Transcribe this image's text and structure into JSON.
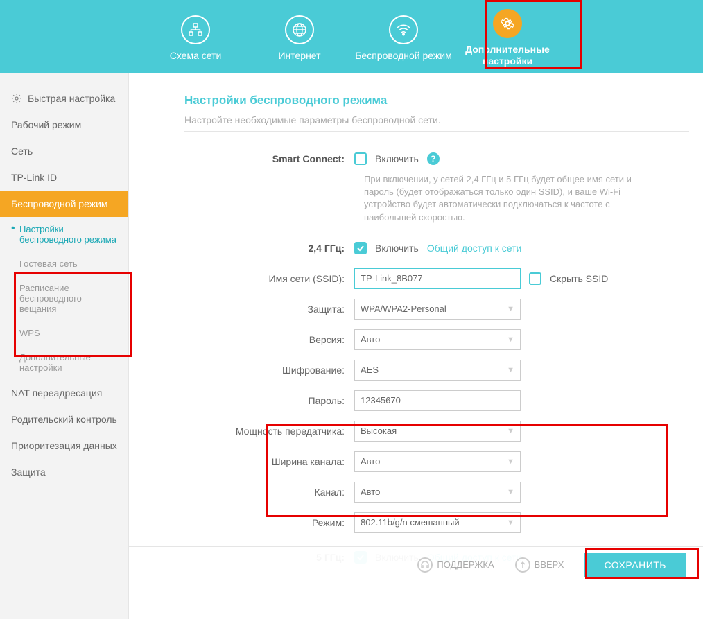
{
  "topnav": {
    "items": [
      {
        "label": "Схема сети"
      },
      {
        "label": "Интернет"
      },
      {
        "label": "Беспроводной режим"
      },
      {
        "label": "Дополнительные настройки"
      }
    ]
  },
  "sidebar": {
    "quick": "Быстрая настройка",
    "items": [
      "Рабочий режим",
      "Сеть",
      "TP-Link ID",
      "Беспроводной режим"
    ],
    "subs": [
      "Настройки беспроводного режима",
      "Гостевая сеть",
      "Расписание беспроводного вещания",
      "WPS",
      "Дополнительные настройки"
    ],
    "items2": [
      "NAT переадресация",
      "Родительский контроль",
      "Приоритезация данных",
      "Защита"
    ]
  },
  "page": {
    "title": "Настройки беспроводного режима",
    "subtitle": "Настройте необходимые параметры беспроводной сети."
  },
  "form": {
    "smart_connect_label": "Smart Connect:",
    "enable": "Включить",
    "smart_hint": "При включении, у сетей 2,4 ГГц и 5 ГГц будет общее имя сети и пароль (будет отображаться только один SSID), и ваше Wi-Fi устройство будет автоматически подключаться к частоте с наибольшей скоростью.",
    "band24_label": "2,4 ГГц:",
    "sharing": "Общий доступ к сети",
    "ssid_label": "Имя сети (SSID):",
    "ssid_value": "TP-Link_8B077",
    "hide_ssid": "Скрыть SSID",
    "security_label": "Защита:",
    "security_value": "WPA/WPA2-Personal",
    "version_label": "Версия:",
    "version_value": "Авто",
    "encryption_label": "Шифрование:",
    "encryption_value": "AES",
    "password_label": "Пароль:",
    "password_value": "12345670",
    "txpower_label": "Мощность передатчика:",
    "txpower_value": "Высокая",
    "chwidth_label": "Ширина канала:",
    "chwidth_value": "Авто",
    "channel_label": "Канал:",
    "channel_value": "Авто",
    "mode_label": "Режим:",
    "mode_value": "802.11b/g/n смешанный",
    "band5_label": "5 ГГц:"
  },
  "footer": {
    "support": "ПОДДЕРЖКА",
    "top": "ВВЕРХ",
    "save": "СОХРАНИТЬ"
  }
}
